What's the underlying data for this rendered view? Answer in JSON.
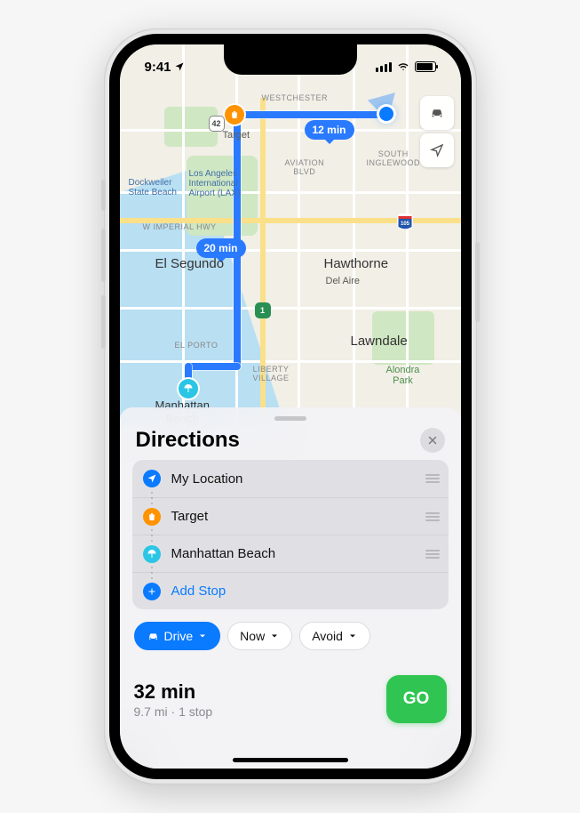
{
  "status": {
    "time": "9:41"
  },
  "map": {
    "labels": {
      "westchester": "WESTCHESTER",
      "south_inglewood": "SOUTH\nINGLEWOOD",
      "target": "Target",
      "lax": "Los Angeles\nInternational\nAirport (LAX)",
      "dockweiler": "Dockweiler\nState Beach",
      "aviation": "AVIATION\nBLVD",
      "imperial": "W IMPERIAL HWY",
      "el_segundo": "El Segundo",
      "hawthorne": "Hawthorne",
      "del_aire": "Del Aire",
      "el_porto": "EL PORTO",
      "lawndale": "Lawndale",
      "liberty": "LIBERTY\nVILLAGE",
      "alondra": "Alondra\nPark",
      "manhattan": "Manhattan\nBeach"
    },
    "shields": {
      "s42": "42",
      "i105": "105",
      "ca1": "1"
    },
    "eta1": "12 min",
    "eta2": "20 min"
  },
  "sheet": {
    "title": "Directions",
    "stops": [
      {
        "label": "My Location",
        "icon": "location",
        "color": "blue"
      },
      {
        "label": "Target",
        "icon": "bag",
        "color": "orange"
      },
      {
        "label": "Manhattan Beach",
        "icon": "umbrella",
        "color": "cyan"
      }
    ],
    "add_stop": "Add Stop",
    "modes": {
      "drive": "Drive",
      "now": "Now",
      "avoid": "Avoid"
    }
  },
  "summary": {
    "time": "32 min",
    "detail": "9.7 mi · 1 stop",
    "go": "GO"
  }
}
